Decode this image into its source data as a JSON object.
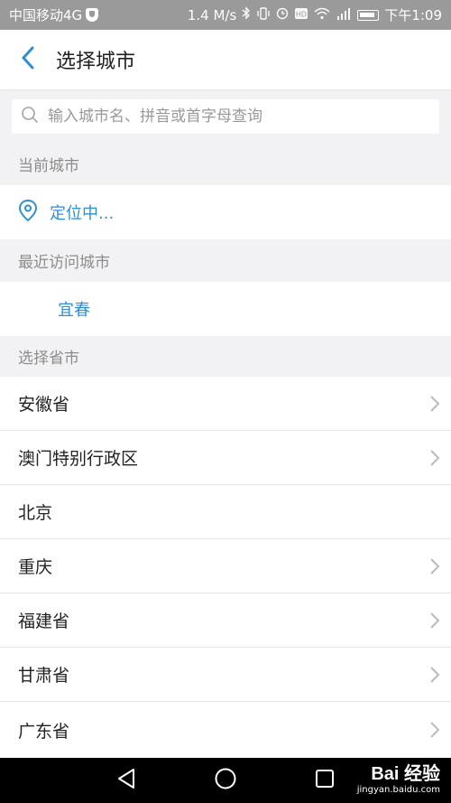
{
  "status_bar": {
    "carrier": "中国移动4G",
    "speed": "1.4 M/s",
    "time": "下午1:09",
    "icons": [
      "bluetooth-icon",
      "vibrate-icon",
      "alarm-icon",
      "hd-icon",
      "wifi-icon",
      "signal-icon",
      "battery-icon"
    ]
  },
  "header": {
    "title": "选择城市",
    "back_icon": "chevron-left-icon"
  },
  "search": {
    "placeholder": "输入城市名、拼音或首字母查询",
    "value": ""
  },
  "current_city": {
    "heading": "当前城市",
    "value": "定位中..."
  },
  "recent": {
    "heading": "最近访问城市",
    "cities": [
      "宜春"
    ]
  },
  "provinces": {
    "heading": "选择省市",
    "items": [
      {
        "label": "安徽省",
        "arrow": true
      },
      {
        "label": "澳门特别行政区",
        "arrow": true
      },
      {
        "label": "北京",
        "arrow": false
      },
      {
        "label": "重庆",
        "arrow": true
      },
      {
        "label": "福建省",
        "arrow": true
      },
      {
        "label": "甘肃省",
        "arrow": true
      },
      {
        "label": "广东省",
        "arrow": true
      }
    ]
  },
  "watermark": {
    "main": "Bai 经验",
    "sub": "jingyan.baidu.com"
  },
  "colors": {
    "accent": "#2f8fd6",
    "status_bar": "#9a9a9a",
    "section_bg": "#f2f2f4"
  }
}
